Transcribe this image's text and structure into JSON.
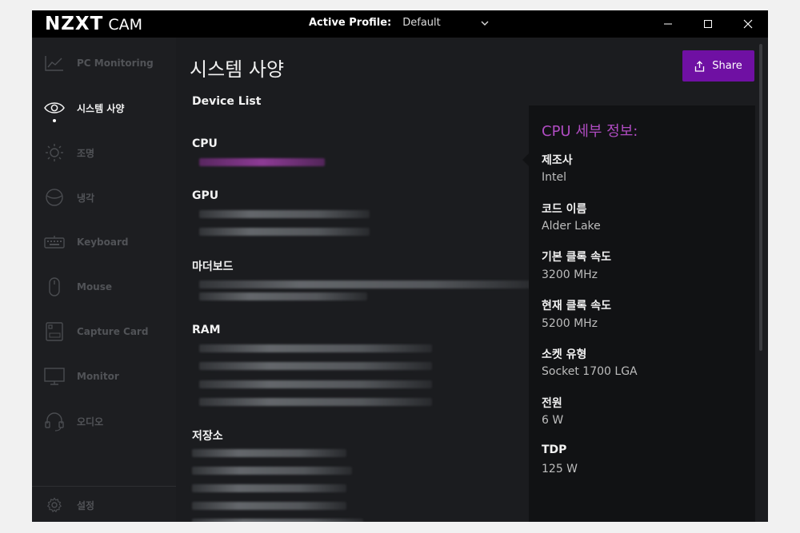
{
  "titlebar": {
    "brand": "NZXT",
    "product": "CAM",
    "profile_label": "Active Profile:",
    "profile_value": "Default"
  },
  "sidebar": {
    "items": [
      {
        "label": "PC Monitoring",
        "icon": "chart-line-icon",
        "active": false
      },
      {
        "label": "시스템 사양",
        "icon": "eye-icon",
        "active": true
      },
      {
        "label": "조명",
        "icon": "sun-icon",
        "active": false
      },
      {
        "label": "냉각",
        "icon": "cooler-icon",
        "active": false
      },
      {
        "label": "Keyboard",
        "icon": "keyboard-icon",
        "active": false
      },
      {
        "label": "Mouse",
        "icon": "mouse-icon",
        "active": false
      },
      {
        "label": "Capture Card",
        "icon": "capture-card-icon",
        "active": false
      },
      {
        "label": "Monitor",
        "icon": "monitor-icon",
        "active": false
      },
      {
        "label": "오디오",
        "icon": "headset-icon",
        "active": false
      }
    ],
    "settings_label": "설정"
  },
  "main": {
    "title": "시스템 사양",
    "share_label": "Share",
    "device_list_title": "Device List",
    "categories": [
      "CPU",
      "GPU",
      "마더보드",
      "RAM",
      "저장소"
    ]
  },
  "detail": {
    "title": "CPU 세부 정보:",
    "specs": [
      {
        "label": "제조사",
        "value": "Intel"
      },
      {
        "label": "코드 이름",
        "value": "Alder Lake"
      },
      {
        "label": "기본 클록 속도",
        "value": "3200 MHz"
      },
      {
        "label": "현재 클록 속도",
        "value": "5200 MHz"
      },
      {
        "label": "소켓 유형",
        "value": "Socket 1700 LGA"
      },
      {
        "label": "전원",
        "value": "6 W"
      },
      {
        "label": "TDP",
        "value": "125 W"
      }
    ]
  },
  "colors": {
    "accent": "#6f10a3",
    "accent_text": "#b04cc2",
    "background": "#1b1c1f",
    "panel": "#111214",
    "titlebar": "#000000"
  }
}
